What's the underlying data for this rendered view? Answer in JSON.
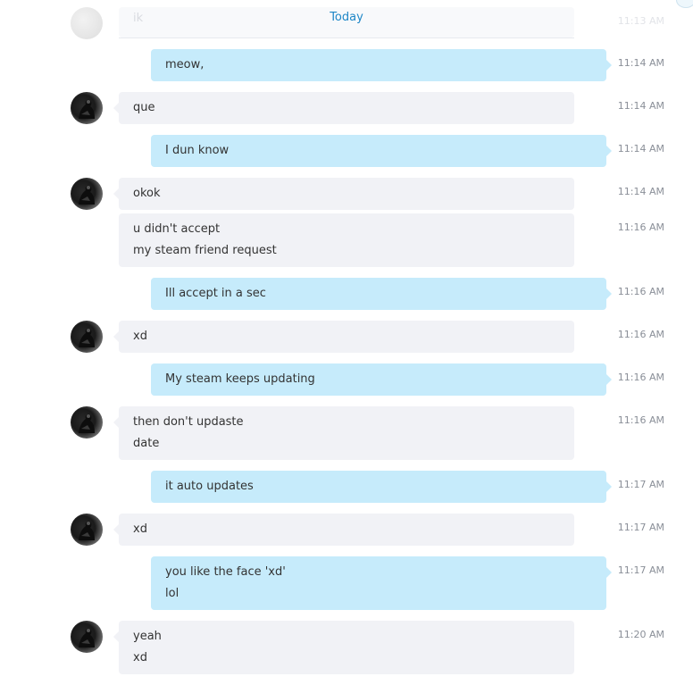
{
  "chat": {
    "date_divider": "Today",
    "top_faded": {
      "text": "ik",
      "time": "11:13 AM"
    },
    "messages": [
      {
        "dir": "out",
        "lines": [
          "meow,"
        ],
        "time": "11:14 AM",
        "avatar": false
      },
      {
        "dir": "in",
        "lines": [
          "que"
        ],
        "time": "11:14 AM",
        "avatar": true
      },
      {
        "dir": "out",
        "lines": [
          "I dun know"
        ],
        "time": "11:14 AM",
        "avatar": false
      },
      {
        "dir": "in",
        "lines": [
          "okok"
        ],
        "time": "11:14 AM",
        "avatar": true
      },
      {
        "dir": "in",
        "lines": [
          "u didn't accept",
          "my steam friend request"
        ],
        "time": "11:16 AM",
        "avatar": false
      },
      {
        "dir": "out",
        "lines": [
          "Ill accept in a sec"
        ],
        "time": "11:16 AM",
        "avatar": false
      },
      {
        "dir": "in",
        "lines": [
          "xd"
        ],
        "time": "11:16 AM",
        "avatar": true
      },
      {
        "dir": "out",
        "lines": [
          "My steam keeps updating"
        ],
        "time": "11:16 AM",
        "avatar": false
      },
      {
        "dir": "in",
        "lines": [
          "then don't updaste",
          "date"
        ],
        "time": "11:16 AM",
        "avatar": true
      },
      {
        "dir": "out",
        "lines": [
          "it auto updates"
        ],
        "time": "11:17 AM",
        "avatar": false
      },
      {
        "dir": "in",
        "lines": [
          "xd"
        ],
        "time": "11:17 AM",
        "avatar": true
      },
      {
        "dir": "out",
        "lines": [
          "you like the face 'xd'",
          "lol"
        ],
        "time": "11:17 AM",
        "avatar": false
      },
      {
        "dir": "in",
        "lines": [
          "yeah",
          "xd"
        ],
        "time": "11:20 AM",
        "avatar": true
      }
    ]
  },
  "colors": {
    "incoming_bubble": "#f1f2f6",
    "outgoing_bubble": "#c6ebfb",
    "date_label": "#1f87c7",
    "timestamp": "#8a8f98"
  }
}
